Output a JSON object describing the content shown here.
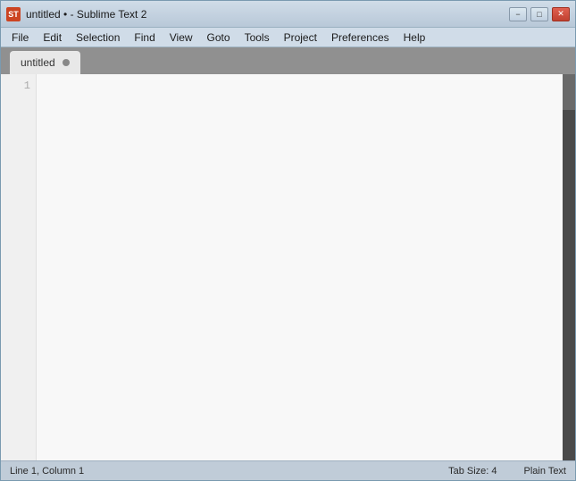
{
  "window": {
    "title": "untitled • - Sublime Text 2",
    "icon_label": "ST"
  },
  "title_controls": {
    "minimize_label": "−",
    "maximize_label": "□",
    "close_label": "✕"
  },
  "menu": {
    "items": [
      {
        "label": "File"
      },
      {
        "label": "Edit"
      },
      {
        "label": "Selection"
      },
      {
        "label": "Find"
      },
      {
        "label": "View"
      },
      {
        "label": "Goto"
      },
      {
        "label": "Tools"
      },
      {
        "label": "Project"
      },
      {
        "label": "Preferences"
      },
      {
        "label": "Help"
      }
    ]
  },
  "tab": {
    "label": "untitled",
    "dot_visible": true
  },
  "editor": {
    "line_numbers": [
      "1"
    ],
    "content": ""
  },
  "status_bar": {
    "position": "Line 1, Column 1",
    "tab_size": "Tab Size: 4",
    "syntax": "Plain Text"
  }
}
